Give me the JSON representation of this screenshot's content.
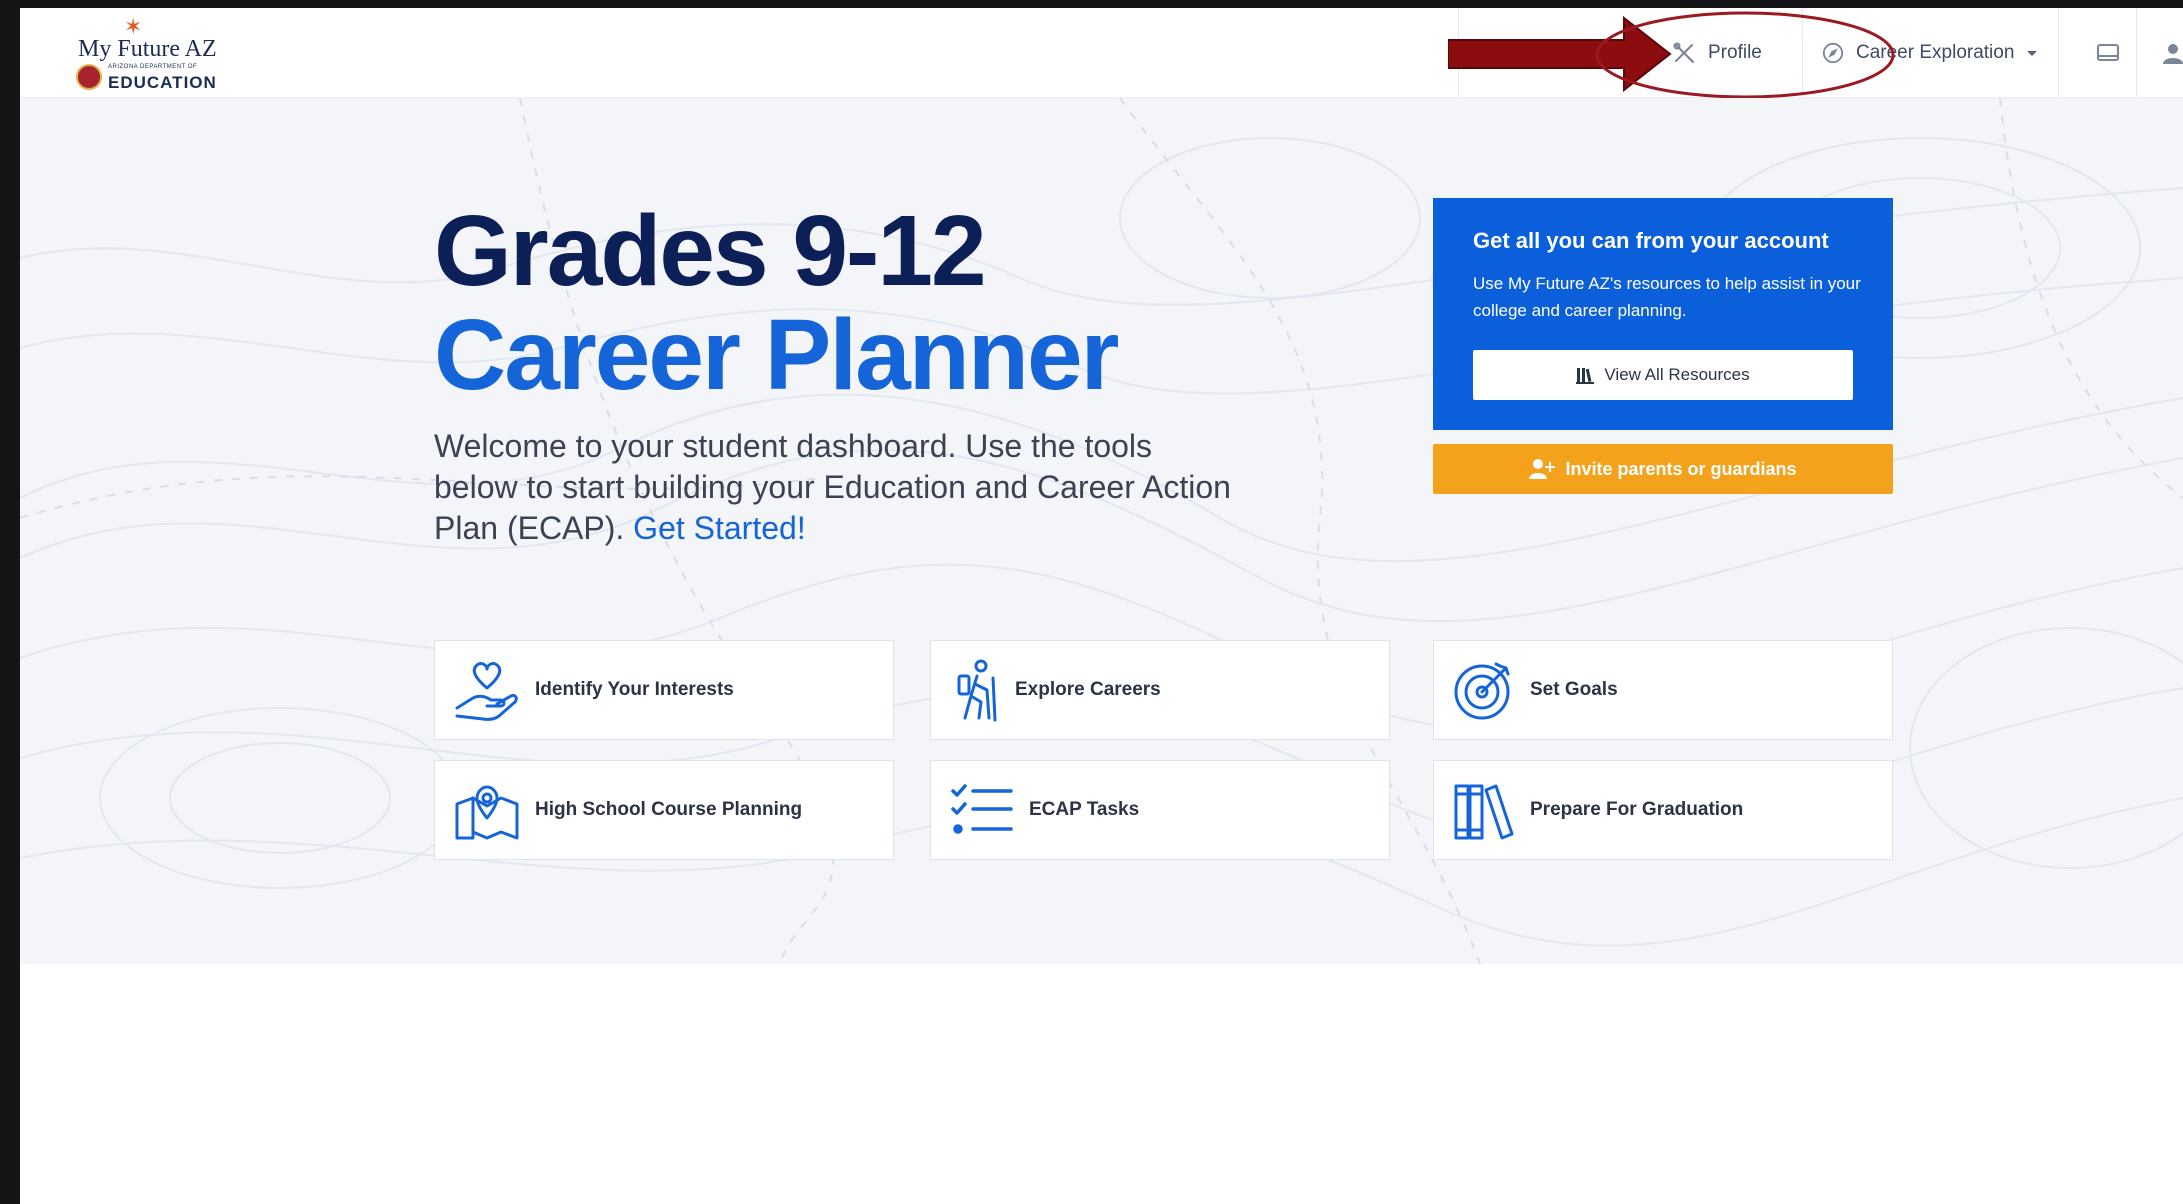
{
  "header": {
    "brand_name": "My Future AZ",
    "brand_dept": "ARIZONA DEPARTMENT OF",
    "brand_sub": "EDUCATION",
    "nav": {
      "profile": "Profile",
      "career_exploration": "Career Exploration"
    }
  },
  "hero": {
    "title_line1": "Grades 9-12",
    "title_line2": "Career Planner",
    "intro_text": "Welcome to your student dashboard. Use the tools below to start building your Education and Career Action Plan (ECAP). ",
    "intro_link": "Get Started!"
  },
  "account_card": {
    "title": "Get all you can from your account",
    "text": "Use My Future AZ's resources to help assist in your college and career planning.",
    "button": "View All Resources"
  },
  "invite_button": "Invite parents or guardians",
  "tiles": [
    {
      "label": "Identify Your Interests",
      "icon": "heart-hand-icon"
    },
    {
      "label": "Explore Careers",
      "icon": "hiker-icon"
    },
    {
      "label": "Set Goals",
      "icon": "target-icon"
    },
    {
      "label": "High School Course Planning",
      "icon": "map-pin-icon"
    },
    {
      "label": "ECAP Tasks",
      "icon": "checklist-icon"
    },
    {
      "label": "Prepare For Graduation",
      "icon": "books-icon"
    }
  ],
  "colors": {
    "navy": "#0c1f56",
    "blue": "#1565d8",
    "card_blue": "#0b5fdb",
    "orange": "#f4a21b",
    "annotation_red": "#8b0d0f"
  }
}
